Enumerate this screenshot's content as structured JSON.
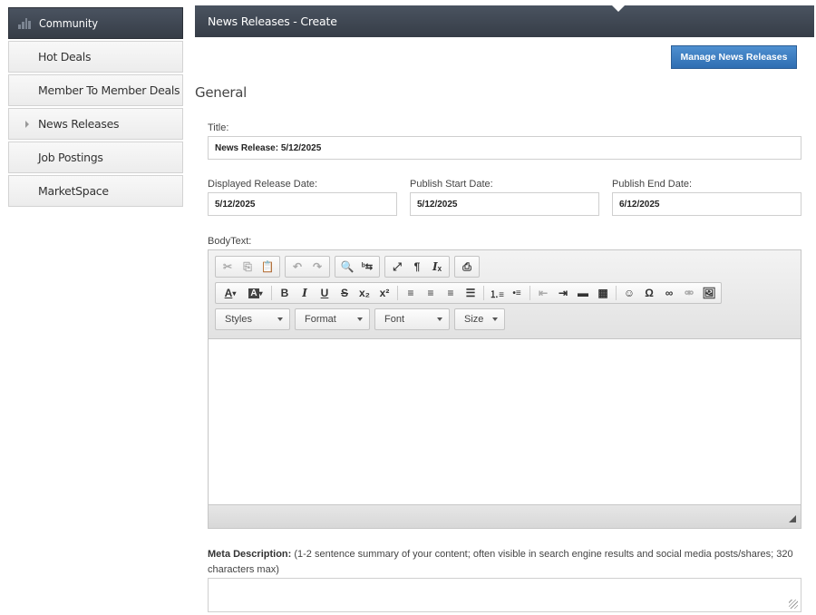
{
  "sidebar": {
    "header": "Community",
    "items": [
      {
        "label": "Hot Deals"
      },
      {
        "label": "Member To Member Deals"
      },
      {
        "label": "News Releases"
      },
      {
        "label": "Job Postings"
      },
      {
        "label": "MarketSpace"
      }
    ]
  },
  "header": {
    "title": "News Releases - Create"
  },
  "manage_button": "Manage News Releases",
  "section_title": "General",
  "form": {
    "title_label": "Title:",
    "title_value": "News Release: 5/12/2025",
    "release_date_label": "Displayed Release Date:",
    "release_date_value": "5/12/2025",
    "publish_start_label": "Publish Start Date:",
    "publish_start_value": "5/12/2025",
    "publish_end_label": "Publish End Date:",
    "publish_end_value": "6/12/2025",
    "body_label": "BodyText:",
    "meta_label_bold": "Meta Description:",
    "meta_label_rest": " (1-2 sentence summary of your content; often visible in search engine results and social media posts/shares; 320 characters max)"
  },
  "editor": {
    "combos": [
      "Styles",
      "Format",
      "Font",
      "Size"
    ]
  }
}
